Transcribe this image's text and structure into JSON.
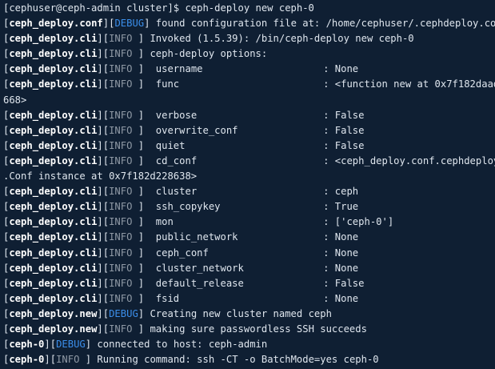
{
  "terminal": {
    "prompt": "[cephuser@ceph-admin cluster]$ ceph-deploy new ceph-0",
    "lines": [
      {
        "module": "ceph_deploy.conf",
        "level": "DEBUG",
        "text": " found configuration file at: /home/cephuser/.cephdeploy.conf"
      },
      {
        "module": "ceph_deploy.cli",
        "level": "INFO ",
        "text": " Invoked (1.5.39): /bin/ceph-deploy new ceph-0"
      },
      {
        "module": "ceph_deploy.cli",
        "level": "INFO ",
        "text": " ceph-deploy options:"
      },
      {
        "module": "ceph_deploy.cli",
        "level": "INFO ",
        "key": "  username",
        "value": ": None"
      },
      {
        "module": "ceph_deploy.cli",
        "level": "INFO ",
        "key": "  func",
        "value": ": <function new at 0x7f182daad"
      },
      {
        "continuation": "668>"
      },
      {
        "module": "ceph_deploy.cli",
        "level": "INFO ",
        "key": "  verbose",
        "value": ": False"
      },
      {
        "module": "ceph_deploy.cli",
        "level": "INFO ",
        "key": "  overwrite_conf",
        "value": ": False"
      },
      {
        "module": "ceph_deploy.cli",
        "level": "INFO ",
        "key": "  quiet",
        "value": ": False"
      },
      {
        "module": "ceph_deploy.cli",
        "level": "INFO ",
        "key": "  cd_conf",
        "value": ": <ceph_deploy.conf.cephdeploy"
      },
      {
        "continuation": ".Conf instance at 0x7f182d228638>"
      },
      {
        "module": "ceph_deploy.cli",
        "level": "INFO ",
        "key": "  cluster",
        "value": ": ceph"
      },
      {
        "module": "ceph_deploy.cli",
        "level": "INFO ",
        "key": "  ssh_copykey",
        "value": ": True"
      },
      {
        "module": "ceph_deploy.cli",
        "level": "INFO ",
        "key": "  mon",
        "value": ": ['ceph-0']"
      },
      {
        "module": "ceph_deploy.cli",
        "level": "INFO ",
        "key": "  public_network",
        "value": ": None"
      },
      {
        "module": "ceph_deploy.cli",
        "level": "INFO ",
        "key": "  ceph_conf",
        "value": ": None"
      },
      {
        "module": "ceph_deploy.cli",
        "level": "INFO ",
        "key": "  cluster_network",
        "value": ": None"
      },
      {
        "module": "ceph_deploy.cli",
        "level": "INFO ",
        "key": "  default_release",
        "value": ": False"
      },
      {
        "module": "ceph_deploy.cli",
        "level": "INFO ",
        "key": "  fsid",
        "value": ": None"
      },
      {
        "module": "ceph_deploy.new",
        "level": "DEBUG",
        "text": " Creating new cluster named ceph"
      },
      {
        "module": "ceph_deploy.new",
        "level": "INFO ",
        "text": " making sure passwordless SSH succeeds"
      },
      {
        "module": "ceph-0",
        "level": "DEBUG",
        "text": " connected to host: ceph-admin"
      },
      {
        "module": "ceph-0",
        "level": "INFO ",
        "text": " Running command: ssh -CT -o BatchMode=yes ceph-0"
      }
    ]
  },
  "colors": {
    "background": "#0f1f33",
    "text": "#dfe6ee",
    "module": "#ffffff",
    "debug": "#3b8eea",
    "info": "#8f99a5"
  }
}
